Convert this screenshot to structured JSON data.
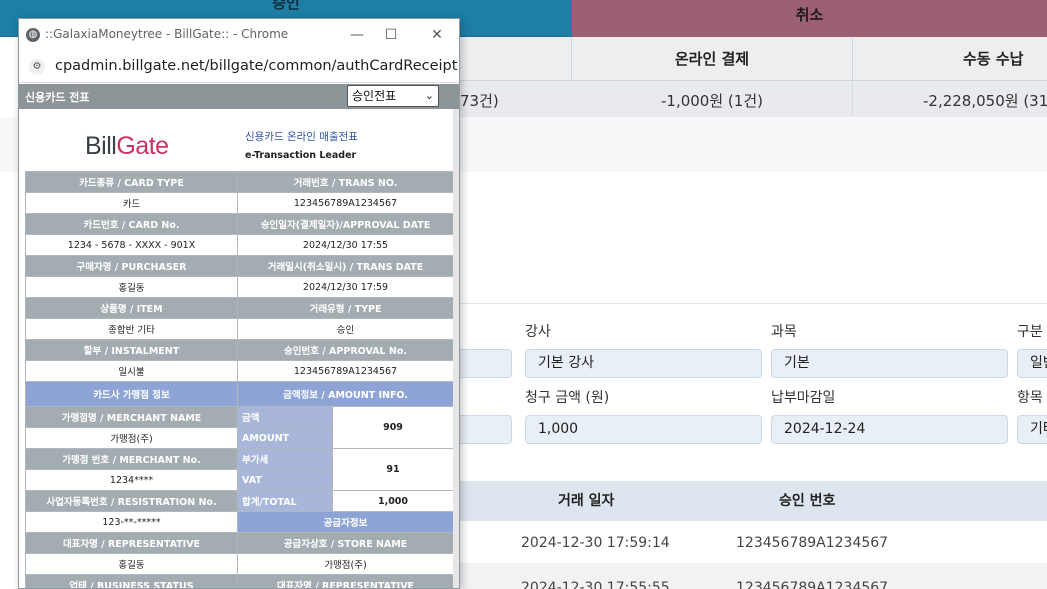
{
  "summary": {
    "approve_header": "승인",
    "cancel_header": "취소",
    "online_payment": "온라인 결제",
    "manual_collection": "수동 수납",
    "approve_amount_fragment": "73건)",
    "cancel_online_amount": "-1,000원 (1건)",
    "cancel_manual_amount": "-2,228,050원 (31"
  },
  "form": {
    "instructor_label": "강사",
    "instructor_value": "기본 강사",
    "subject_label": "과목",
    "subject_value": "기본",
    "category_label": "구분",
    "category_value": "일반",
    "billing_amount_label": "청구 금액 (원)",
    "billing_amount_value": "1,000",
    "due_date_label": "납부마감일",
    "due_date_value": "2024-12-24",
    "item_label": "항목",
    "item_value": "기타"
  },
  "list": {
    "col_trans_date": "거래 일자",
    "col_approval_no": "승인 번호",
    "rows": [
      {
        "date": "2024-12-30 17:59:14",
        "approval": "123456789A1234567"
      },
      {
        "date": "2024-12-30 17:55:55",
        "approval": "123456789A1234567"
      }
    ]
  },
  "popup": {
    "window_title": "::GalaxiaMoneytree - BillGate:: - Chrome",
    "url": "cpadmin.billgate.net/billgate/common/authCardReceipt.jsp...",
    "receipt_title": "신용카드 전표",
    "receipt_select": "승인전표",
    "logo_bill": "Bill",
    "logo_gate": "Gate",
    "logo_sub1": "신용카드 온라인 매출전표",
    "logo_sub2": "e-Transaction Leader",
    "card_type_h": "카드종류 / CARD TYPE",
    "trans_no_h": "거래번호 / TRANS NO.",
    "card_type_v": "카드",
    "trans_no_v": "123456789A1234567",
    "card_no_h": "카드번호 / CARD No.",
    "approval_date_h": "승인일자(결제일자)/APPROVAL DATE",
    "card_no_v": "1234 - 5678 - XXXX - 901X",
    "approval_date_v": "2024/12/30 17:55",
    "purchaser_h": "구매자명 / PURCHASER",
    "trans_date_h": "거래일시(취소일시) / TRANS DATE",
    "purchaser_v": "홍길동",
    "trans_date_v": "2024/12/30 17:59",
    "item_h": "상품명 / ITEM",
    "type_h": "거래유형 / TYPE",
    "item_v": "종합반 기타",
    "type_v": "승인",
    "instalment_h": "할부 / INSTALMENT",
    "approval_no_h": "승인번호 / APPROVAL No.",
    "instalment_v": "일시불",
    "approval_no_v": "123456789A1234567",
    "merchant_info_h": "카드사 가맹점 정보",
    "amount_info_h": "금액정보 / AMOUNT INFO.",
    "merchant_name_h": "가맹점명 / MERCHANT NAME",
    "amount_kr": "금액",
    "amount_en": "AMOUNT",
    "amount_v": "909",
    "merchant_name_v": "가맹점(주)",
    "merchant_no_h": "가맹점 번호 / MERCHANT No.",
    "vat_kr": "부가세",
    "vat_en": "VAT",
    "vat_v": "91",
    "merchant_no_v": "1234****",
    "registration_h": "사업자등록번호 / RESISTRATION No.",
    "total_lbl": "합계/TOTAL",
    "total_v": "1,000",
    "registration_v": "123-**-*****",
    "supplier_info_h": "공급자정보",
    "representative_h": "대표자명 / REPRESENTATIVE",
    "store_name_h": "공급자상호 / STORE NAME",
    "representative_v": "홍길동",
    "store_name_v": "가맹점(주)",
    "business_status_h": "업태 / BUSINESS STATUS",
    "representative2_h": "대표자명 / REPRESENTATIVE"
  }
}
